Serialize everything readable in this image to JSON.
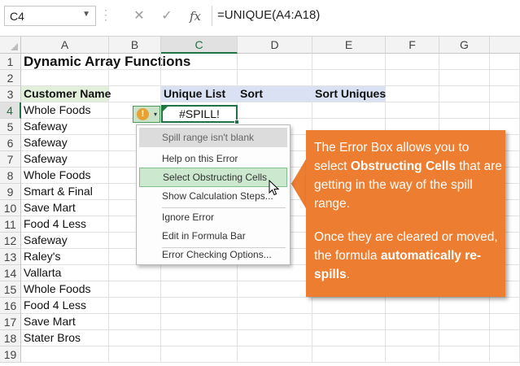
{
  "formula_bar": {
    "name_box": "C4",
    "cancel_icon": "close-icon",
    "enter_icon": "check-icon",
    "fx_label": "fx",
    "formula": "=UNIQUE(A4:A18)"
  },
  "columns": [
    "A",
    "B",
    "C",
    "D",
    "E",
    "F",
    "G"
  ],
  "selected_column": "C",
  "rows": [
    "1",
    "2",
    "3",
    "4",
    "5",
    "6",
    "7",
    "8",
    "9",
    "10",
    "11",
    "12",
    "13",
    "14",
    "15",
    "16",
    "17",
    "18",
    "19"
  ],
  "selected_row": "4",
  "sheet": {
    "title": "Dynamic Array Functions",
    "headers": {
      "customer_name": "Customer Name",
      "unique_list": "Unique List",
      "sort": "Sort",
      "sort_uniques": "Sort Uniques"
    },
    "customers": [
      "Whole Foods",
      "Safeway",
      "Safeway",
      "Safeway",
      "Whole Foods",
      "Smart & Final",
      "Save Mart",
      "Food 4 Less",
      "Safeway",
      "Raley's",
      "Vallarta",
      "Whole Foods",
      "Food 4 Less",
      "Save Mart",
      "Stater Bros"
    ],
    "active_cell_value": "#SPILL!",
    "colors": {
      "header_green": "#e2efda",
      "header_blue": "#d9e1f2",
      "accent": "#217346"
    }
  },
  "error_button": {
    "icon": "exclamation-icon",
    "glyph": "!",
    "caret": "▾"
  },
  "error_menu": {
    "items": [
      "Spill range isn't blank",
      "Help on this Error",
      "Select Obstructing Cells",
      "Show Calculation Steps...",
      "Ignore Error",
      "Edit in Formula Bar",
      "Error Checking Options..."
    ],
    "hovered": "Select Obstructing Cells"
  },
  "callout": {
    "color": "#ed7d31",
    "p1_a": "The Error Box allows you to select ",
    "p1_bold": "Obstructing Cells",
    "p1_b": " that are getting in the way of the spill range.",
    "p2_a": "Once they are cleared or moved, the formula ",
    "p2_bold": "automatically re-spills",
    "p2_b": "."
  }
}
